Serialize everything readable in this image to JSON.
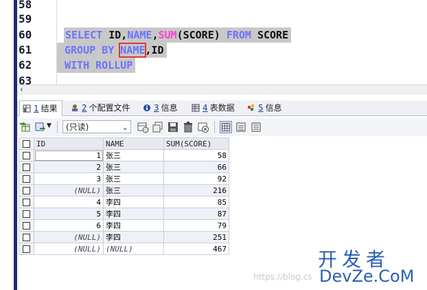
{
  "editor": {
    "line_numbers": [
      "58",
      "59",
      "60",
      "61",
      "62",
      "63"
    ],
    "lines": [
      {
        "parts": [
          {
            "t": "SELECT",
            "k": "kw"
          },
          {
            "t": " ID,",
            "k": "id"
          },
          {
            "t": "NAME",
            "k": "kw"
          },
          {
            "t": ",",
            "k": "id"
          },
          {
            "t": "SUM",
            "k": "fn"
          },
          {
            "t": "(SCORE) ",
            "k": "id"
          },
          {
            "t": "FROM",
            "k": "kw"
          },
          {
            "t": " SCORE",
            "k": "id"
          }
        ]
      },
      {
        "parts": [
          {
            "t": "GROUP BY ",
            "k": "kw"
          },
          {
            "t": "NAME",
            "k": "kw",
            "box": true
          },
          {
            "t": ",ID",
            "k": "id"
          }
        ]
      },
      {
        "parts": [
          {
            "t": "WITH ROLLUP",
            "k": "kw"
          }
        ]
      }
    ]
  },
  "tabs": [
    {
      "num": "1",
      "label": "结果",
      "active": true,
      "icon": "result-grid-icon"
    },
    {
      "num": "2",
      "label": "个配置文件",
      "active": false,
      "icon": "profile-icon"
    },
    {
      "num": "3",
      "label": "信息",
      "active": false,
      "icon": "info-icon"
    },
    {
      "num": "4",
      "label": "表数据",
      "active": false,
      "icon": "table-data-icon"
    },
    {
      "num": "5",
      "label": "信息",
      "active": false,
      "icon": "info-blocks-icon"
    }
  ],
  "toolbar": {
    "mode_select": "(只读)"
  },
  "grid": {
    "columns": [
      "ID",
      "NAME",
      "SUM(SCORE)"
    ],
    "rows": [
      {
        "id": "1",
        "name": "张三",
        "sum": "58"
      },
      {
        "id": "2",
        "name": "张三",
        "sum": "66"
      },
      {
        "id": "3",
        "name": "张三",
        "sum": "92"
      },
      {
        "id": "(NULL)",
        "name": "张三",
        "sum": "216"
      },
      {
        "id": "4",
        "name": "李四",
        "sum": "85"
      },
      {
        "id": "5",
        "name": "李四",
        "sum": "87"
      },
      {
        "id": "6",
        "name": "李四",
        "sum": "79"
      },
      {
        "id": "(NULL)",
        "name": "李四",
        "sum": "251"
      },
      {
        "id": "(NULL)",
        "name": "(NULL)",
        "sum": "467"
      }
    ]
  },
  "watermark": {
    "url": "https://blog.cs",
    "logo_cn": "开发者",
    "logo_en": "DevZe.CoM"
  },
  "colors": {
    "keyword": "#6b73ff",
    "function": "#ff3fd0",
    "highlight_box": "#e23636",
    "selection": "#c8c8c8",
    "logo": "#2b5fb3"
  }
}
